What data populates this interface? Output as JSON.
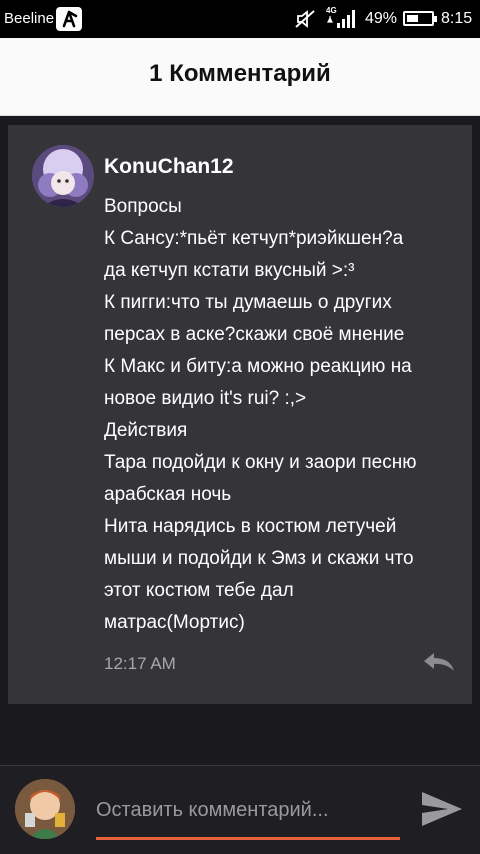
{
  "status_bar": {
    "carrier": "Beeline",
    "network": "4G",
    "battery_percent": "49%",
    "battery_level": 0.49,
    "time": "8:15"
  },
  "header": {
    "title": "1 Комментарий"
  },
  "comment": {
    "username": "KonuChan12",
    "lines": [
      "Вопросы",
      "К Сансу:*пьёт кетчуп*риэйкшен?а",
      "да кетчуп кстати вкусный >:³",
      "К пигги:что ты думаешь о других",
      "персах в аске?скажи своё мнение",
      "К Макс и биту:а можно реакцию на",
      "новое видио it's rui? :,>",
      "Действия",
      "Тара подойди к окну и заори песню",
      "арабская ночь",
      "Нита нарядись в костюм летучей",
      "мыши и подойди к Эмз и скажи что",
      "этот костюм тебе дал",
      "матрас(Мортис)"
    ],
    "timestamp": "12:17 AM"
  },
  "composer": {
    "placeholder": "Оставить комментарий..."
  },
  "colors": {
    "accent": "#e8613a",
    "card_bg": "#353438",
    "page_bg": "#1a191d"
  },
  "icons": [
    "app-badge-icon",
    "mute-icon",
    "signal-icon",
    "battery-icon",
    "reply-icon",
    "send-icon"
  ]
}
